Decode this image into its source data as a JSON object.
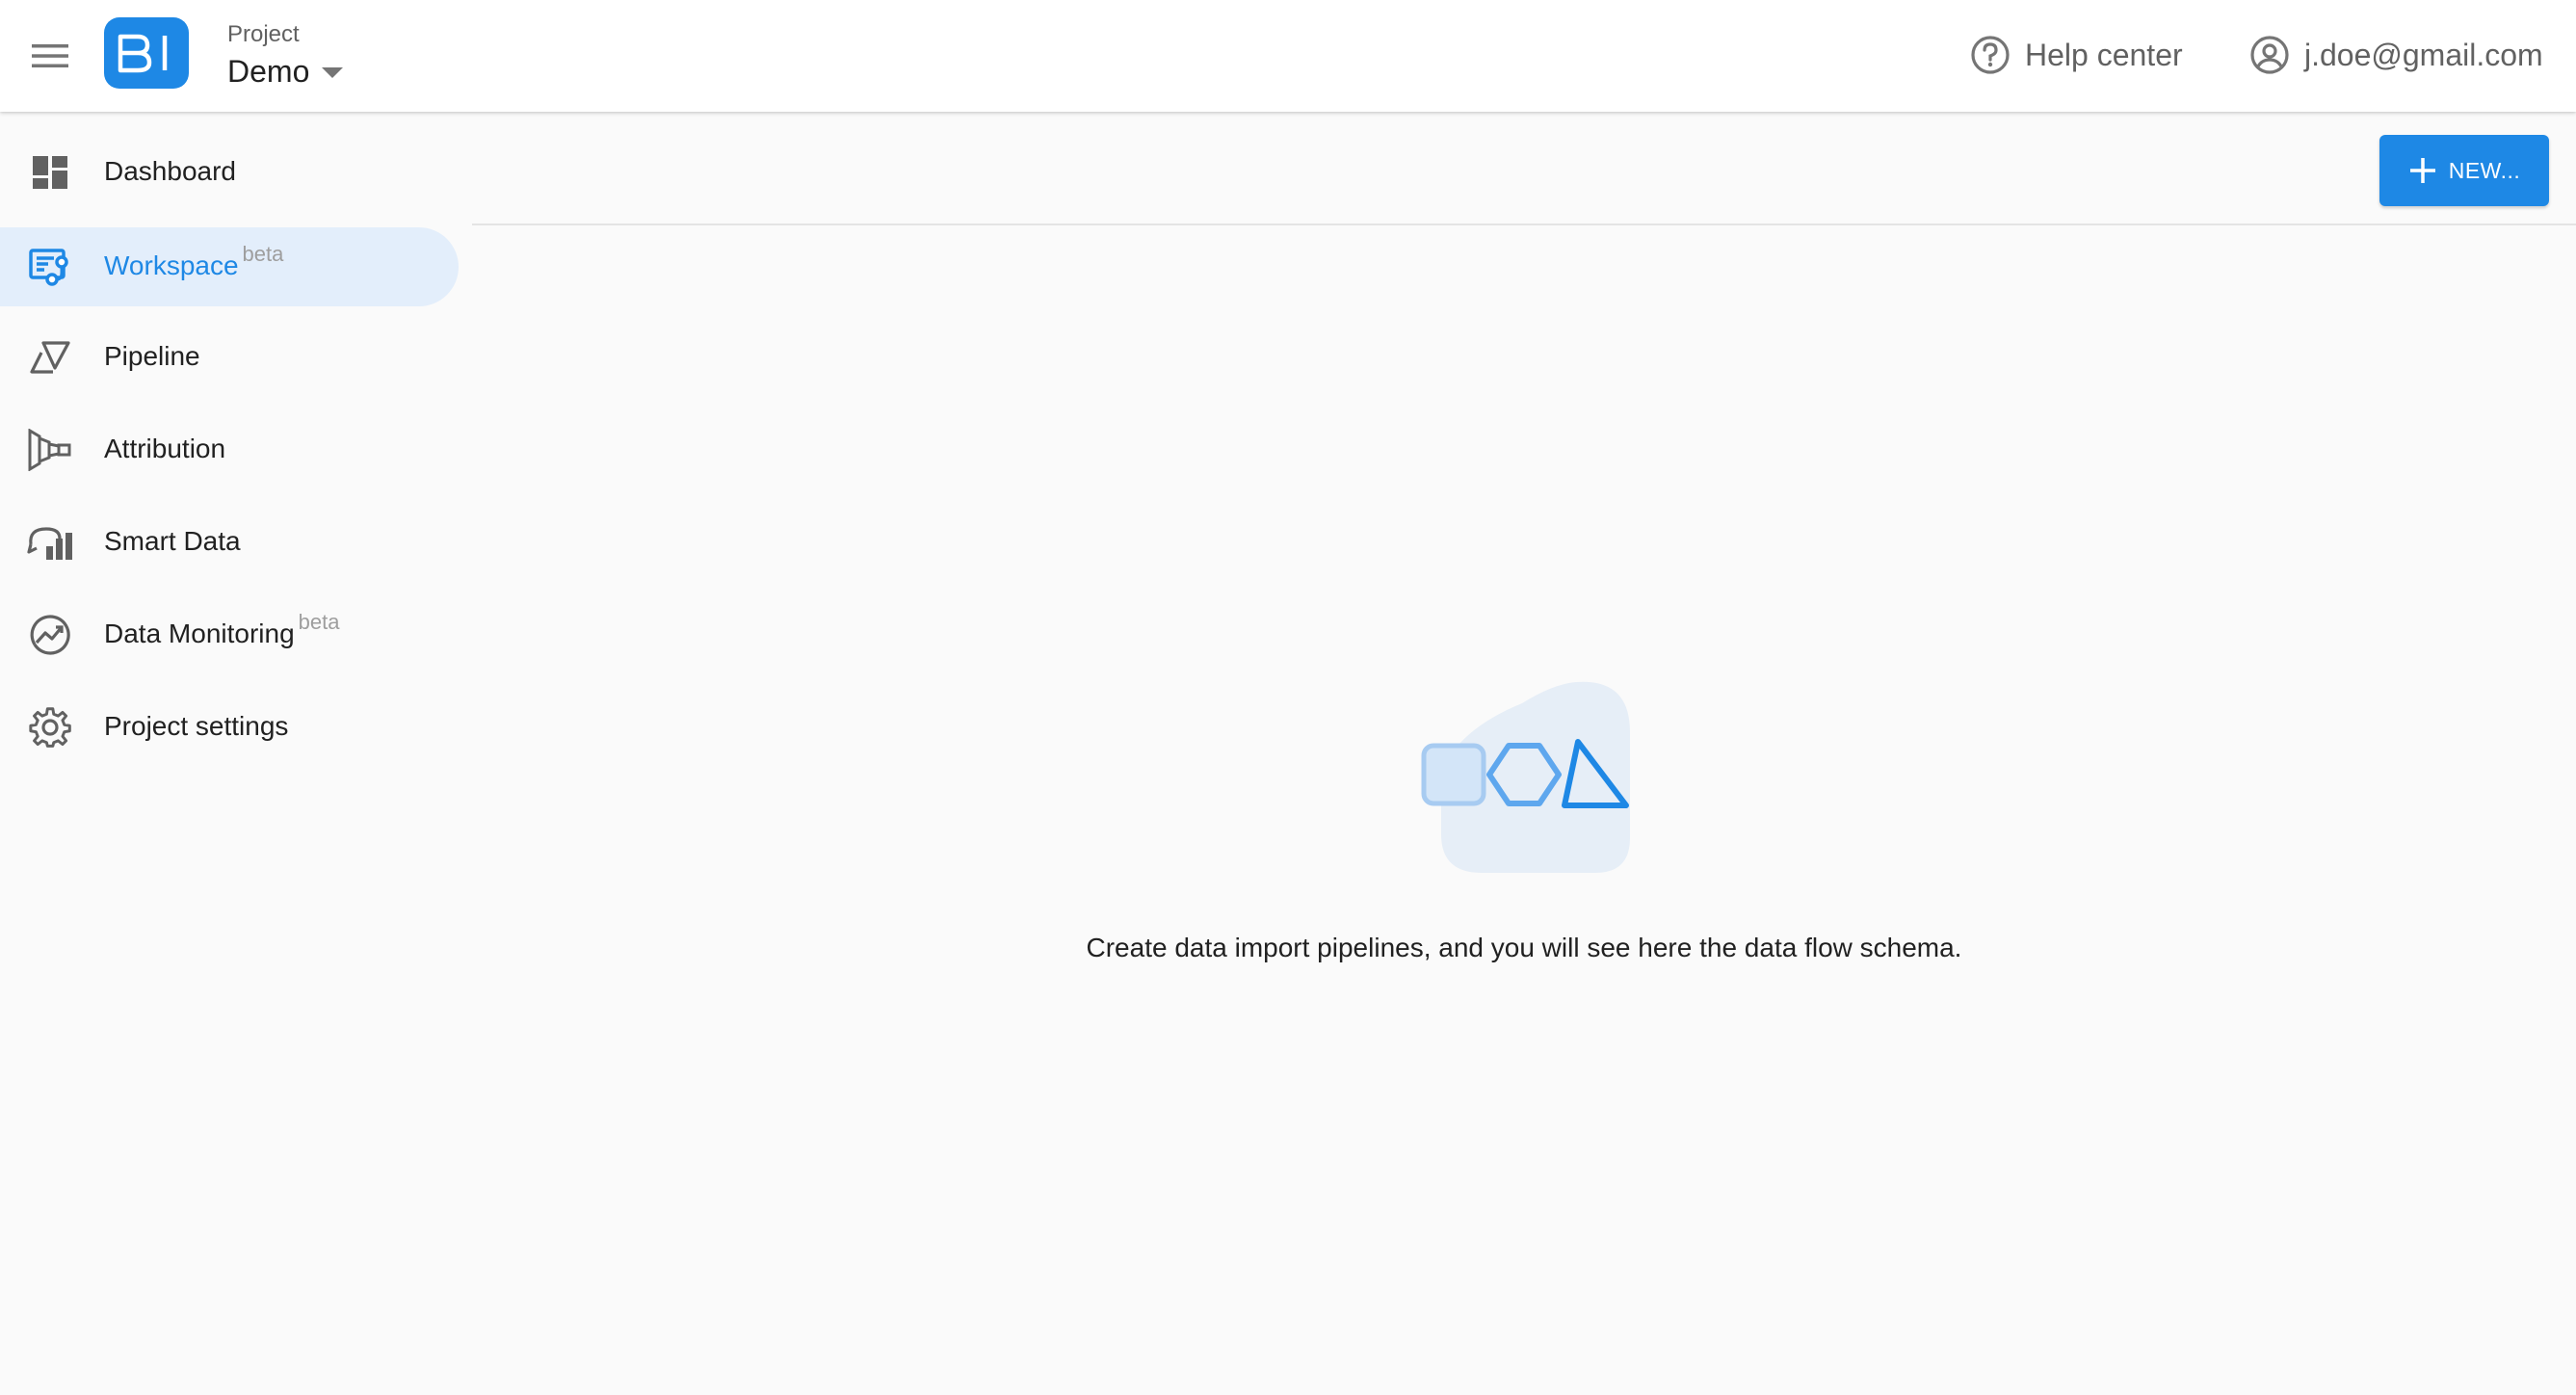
{
  "header": {
    "logo_text": "BI",
    "project_label": "Project",
    "project_name": "Demo",
    "help_label": "Help center",
    "user_email": "j.doe@gmail.com"
  },
  "sidebar": {
    "items": [
      {
        "label": "Dashboard",
        "badge": "",
        "icon": "dashboard-icon",
        "active": false
      },
      {
        "label": "Workspace",
        "badge": "beta",
        "icon": "workspace-icon",
        "active": true
      },
      {
        "label": "Pipeline",
        "badge": "",
        "icon": "pipeline-icon",
        "active": false
      },
      {
        "label": "Attribution",
        "badge": "",
        "icon": "attribution-icon",
        "active": false
      },
      {
        "label": "Smart Data",
        "badge": "",
        "icon": "smart-data-icon",
        "active": false
      },
      {
        "label": "Data Monitoring",
        "badge": "beta",
        "icon": "data-monitoring-icon",
        "active": false
      },
      {
        "label": "Project settings",
        "badge": "",
        "icon": "gear-icon",
        "active": false
      }
    ]
  },
  "toolbar": {
    "new_label": "NEW..."
  },
  "main": {
    "empty_message": "Create data import pipelines, and you will see here the data flow schema."
  },
  "colors": {
    "accent": "#1e88e5",
    "active_nav_bg": "#e3eefb",
    "page_bg": "#fafafa"
  }
}
